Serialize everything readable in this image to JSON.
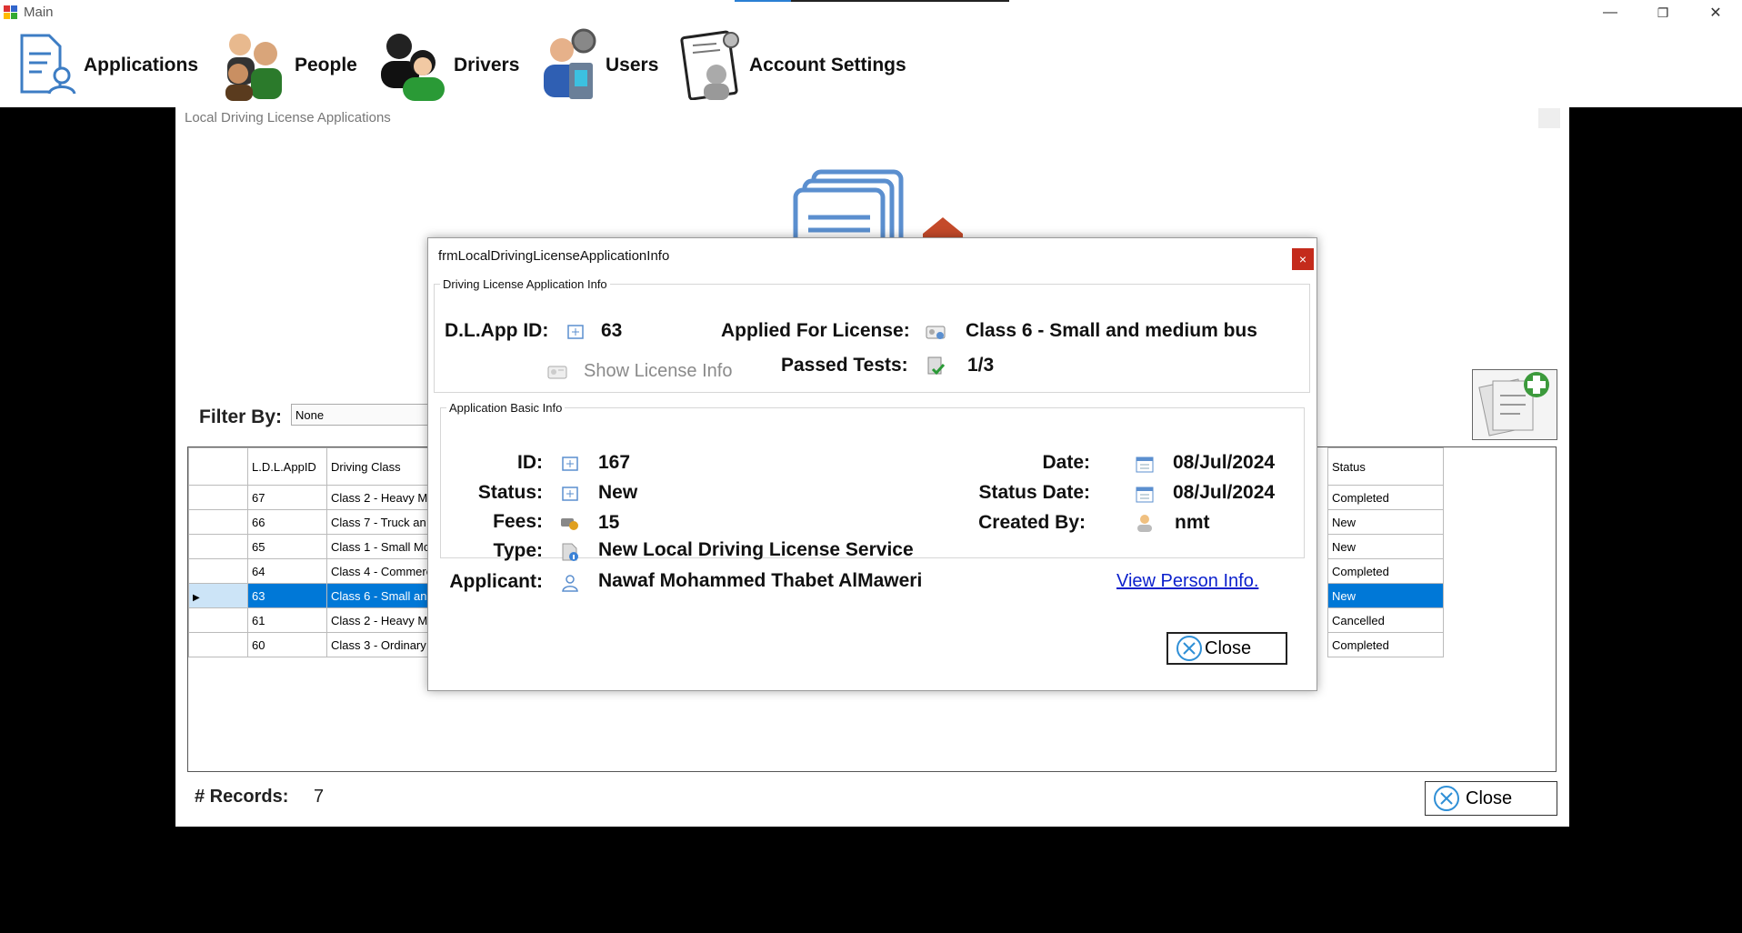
{
  "main": {
    "title": "Main",
    "menu": [
      {
        "label": "Applications",
        "icon": "applications-icon"
      },
      {
        "label": "People",
        "icon": "people-icon"
      },
      {
        "label": "Drivers",
        "icon": "drivers-icon"
      },
      {
        "label": "Users",
        "icon": "users-icon"
      },
      {
        "label": "Account Settings",
        "icon": "account-settings-icon"
      }
    ],
    "controls": {
      "minimize": "—",
      "restore": "❐",
      "close": "✕"
    }
  },
  "ldl": {
    "title": "Local Driving License Applications",
    "filter_label": "Filter By:",
    "filter_value": "None",
    "columns": [
      "L.D.L.AppID",
      "Driving Class"
    ],
    "status_header": "Status",
    "rows": [
      {
        "id": "67",
        "class": "Class 2 - Heavy M",
        "status": "Completed",
        "selected": false
      },
      {
        "id": "66",
        "class": "Class 7 - Truck an",
        "status": "New",
        "selected": false
      },
      {
        "id": "65",
        "class": "Class 1 - Small Mot",
        "status": "New",
        "selected": false
      },
      {
        "id": "64",
        "class": "Class 4 - Commerc",
        "status": "Completed",
        "selected": false
      },
      {
        "id": "63",
        "class": "Class 6 - Small and",
        "status": "New",
        "selected": true
      },
      {
        "id": "61",
        "class": "Class 2 - Heavy M",
        "status": "Cancelled",
        "selected": false
      },
      {
        "id": "60",
        "class": "Class 3 - Ordinary",
        "status": "Completed",
        "selected": false
      }
    ],
    "records_label": "# Records:",
    "records_value": "7",
    "close_label": "Close"
  },
  "dialog": {
    "title": "frmLocalDrivingLicenseApplicationInfo",
    "close_x": "×",
    "group1": {
      "legend": "Driving License Application Info",
      "dl_app_id_label": "D.L.App ID:",
      "dl_app_id": "63",
      "applied_for_label": "Applied For License:",
      "applied_for": "Class 6 - Small and medium bus",
      "show_license_info": "Show License Info",
      "passed_tests_label": "Passed Tests:",
      "passed_tests": "1/3"
    },
    "group2": {
      "legend": "Application Basic Info",
      "id_label": "ID:",
      "id": "167",
      "status_label": "Status:",
      "status": "New",
      "fees_label": "Fees:",
      "fees": "15",
      "type_label": "Type:",
      "type": "New Local Driving License Service",
      "applicant_label": "Applicant:",
      "applicant": "Nawaf Mohammed Thabet AlMaweri",
      "date_label": "Date:",
      "date": "08/Jul/2024",
      "status_date_label": "Status Date:",
      "status_date": "08/Jul/2024",
      "created_by_label": "Created By:",
      "created_by": "nmt",
      "view_person_link": "View Person Info."
    },
    "close_label": "Close"
  },
  "colors": {
    "selection": "#0078d7",
    "dialog_close": "#c42b1c",
    "link": "#0a1fcc",
    "accent_icon": "#5b8fcf"
  }
}
